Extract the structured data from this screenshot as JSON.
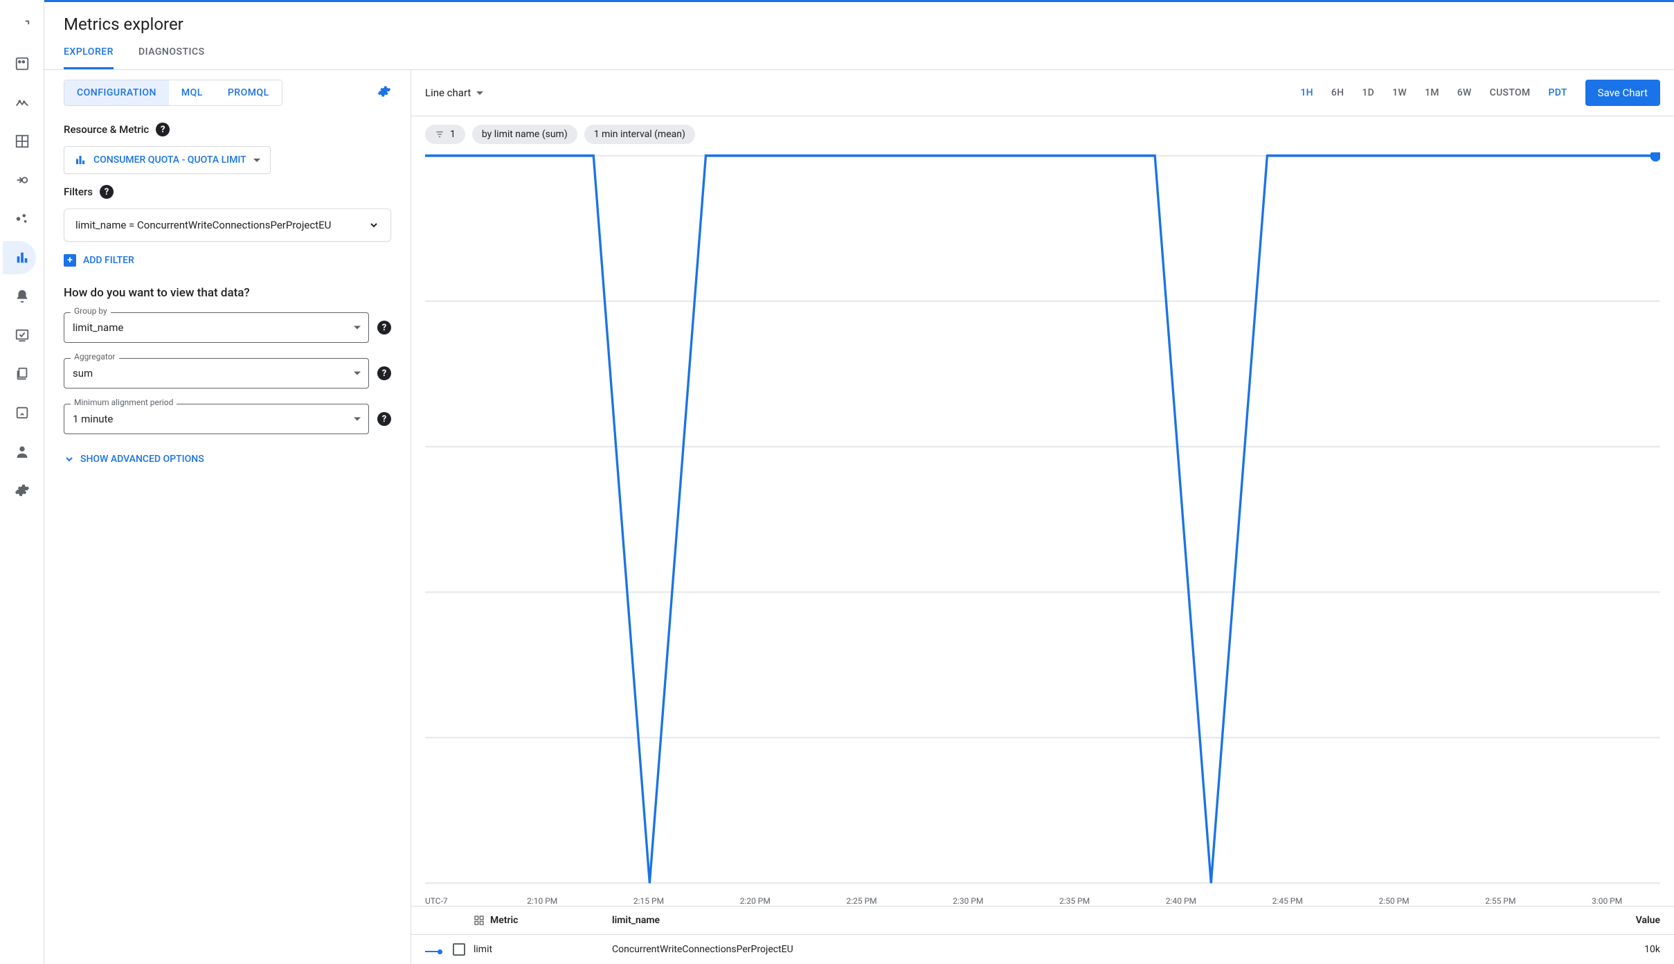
{
  "header": {
    "title": "Metrics explorer"
  },
  "tabs": [
    {
      "label": "EXPLORER",
      "active": true
    },
    {
      "label": "DIAGNOSTICS",
      "active": false
    }
  ],
  "subtabs": [
    {
      "label": "CONFIGURATION",
      "active": true
    },
    {
      "label": "MQL",
      "active": false
    },
    {
      "label": "PROMQL",
      "active": false
    }
  ],
  "config": {
    "resource_metric_label": "Resource & Metric",
    "metric_selected": "CONSUMER QUOTA - QUOTA LIMIT",
    "filters_label": "Filters",
    "filter_expression": "limit_name = ConcurrentWriteConnectionsPerProjectEU",
    "add_filter_label": "ADD FILTER",
    "view_question": "How do you want to view that data?",
    "group_by": {
      "legend": "Group by",
      "value": "limit_name"
    },
    "aggregator": {
      "legend": "Aggregator",
      "value": "sum"
    },
    "min_align": {
      "legend": "Minimum alignment period",
      "value": "1 minute"
    },
    "show_advanced": "SHOW ADVANCED OPTIONS"
  },
  "chart_toolbar": {
    "chart_type": "Line chart",
    "time_ranges": [
      "1H",
      "6H",
      "1D",
      "1W",
      "1M",
      "6W",
      "CUSTOM"
    ],
    "active_range": "1H",
    "timezone": "PDT",
    "save_label": "Save Chart"
  },
  "chips": {
    "filter_count": "1",
    "groupby": "by limit name (sum)",
    "interval": "1 min interval (mean)"
  },
  "chart_data": {
    "type": "line",
    "timezone_label": "UTC-7",
    "x_ticks": [
      "2:10 PM",
      "2:15 PM",
      "2:20 PM",
      "2:25 PM",
      "2:30 PM",
      "2:35 PM",
      "2:40 PM",
      "2:45 PM",
      "2:50 PM",
      "2:55 PM",
      "3:00 PM"
    ],
    "series": [
      {
        "name": "limit",
        "limit_name": "ConcurrentWriteConnectionsPerProjectEU",
        "value_display": "10k",
        "color": "#1a73e8",
        "values": [
          10000,
          10000,
          10000,
          10000,
          0,
          10000,
          10000,
          10000,
          10000,
          10000,
          10000,
          10000,
          10000,
          10000,
          0,
          10000,
          10000,
          10000,
          10000,
          10000,
          10000,
          10000,
          10000
        ]
      }
    ],
    "ylim": [
      0,
      10000
    ]
  },
  "legend": {
    "metric_header": "Metric",
    "limit_header": "limit_name",
    "value_header": "Value"
  }
}
